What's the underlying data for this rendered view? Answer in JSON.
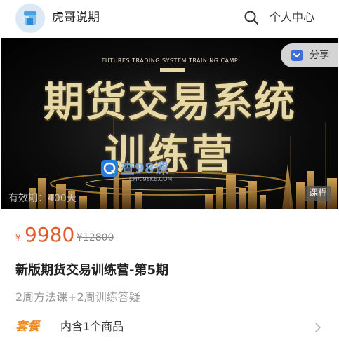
{
  "header": {
    "shop_name": "虎哥说期",
    "user_center": "个人中心",
    "icons": {
      "logo": "shop-logo-icon",
      "search": "search-icon"
    }
  },
  "banner": {
    "subtitle": "FUTURES TRADING SYSTEM TRAINING CAMP",
    "title_line1": "期货交易系统",
    "title_line2": "训练营",
    "watermark_text": "查98课",
    "watermark_url": "CHA.98KE.COM",
    "validity": "有效期：400天",
    "tag": "课程",
    "share": {
      "label": "分享",
      "icon": "share-icon"
    }
  },
  "price": {
    "symbol": "¥",
    "current": "9980",
    "original": "¥12800",
    "color": "#e55a2b"
  },
  "course": {
    "name": "新版期货交易训练营-第5期",
    "description": "2周方法课+2周训练答疑"
  },
  "package": {
    "badge": "套餐",
    "text": "内含1个商品",
    "badge_color": "#f08a24",
    "icon": "chevron-right-icon"
  }
}
